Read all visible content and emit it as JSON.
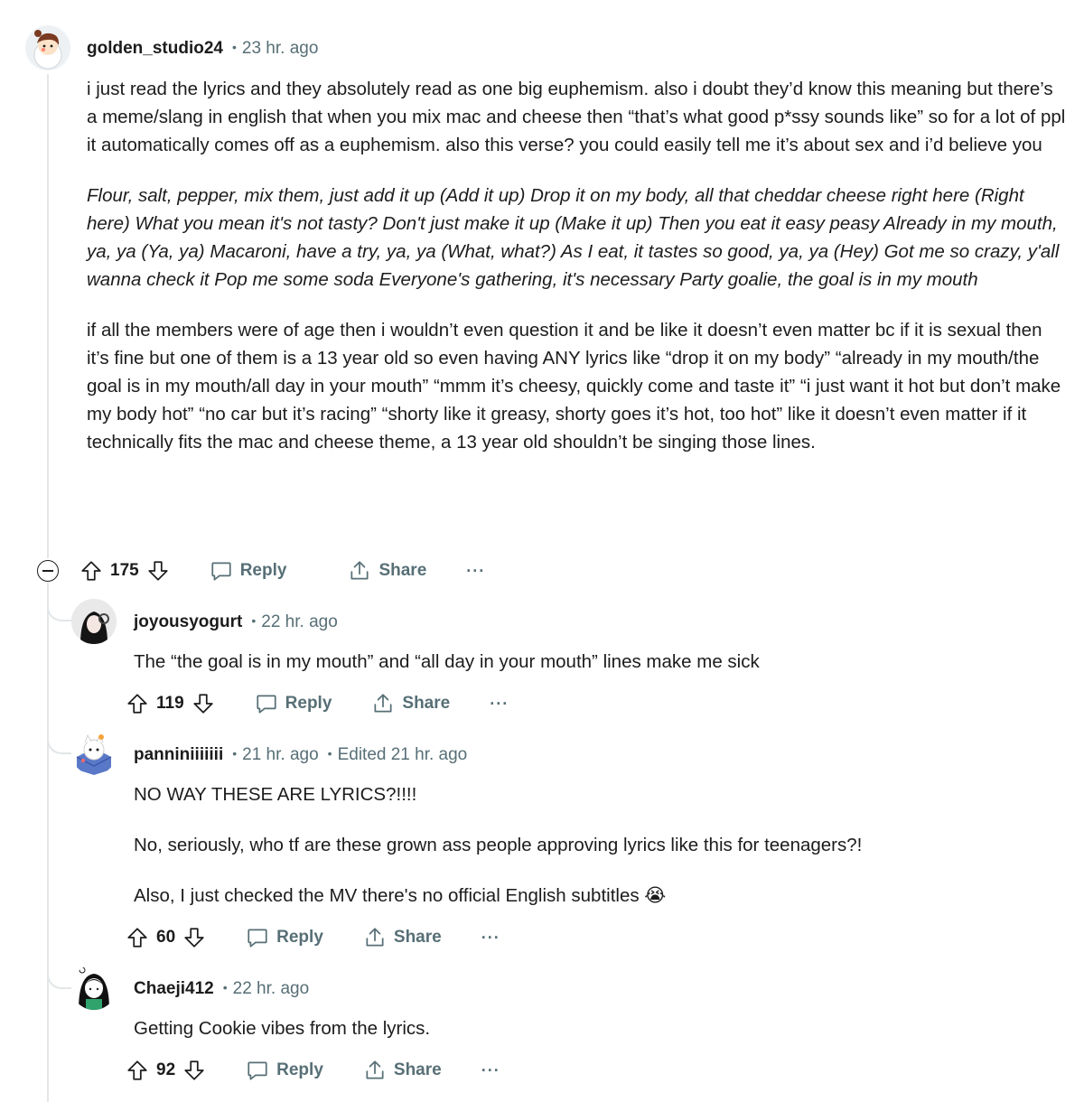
{
  "comments": [
    {
      "user": "golden_studio24",
      "time": "23 hr. ago",
      "paragraphs": [
        "i just read the lyrics and they absolutely read as one big euphemism. also i doubt they’d know this meaning but there’s a meme/slang in english that when you mix mac and cheese then “that’s what good p*ssy sounds like” so for a lot of ppl it automatically comes off as a euphemism. also this verse? you could easily tell me it’s about sex and i’d believe you",
        "Flour, salt, pepper, mix them, just add it up (Add it up) Drop it on my body, all that cheddar cheese right here (Right here) What you mean it's not tasty? Don't just make it up (Make it up) Then you eat it easy peasy Already in my mouth, ya, ya (Ya, ya) Macaroni, have a try, ya, ya (What, what?) As I eat, it tastes so good, ya, ya (Hey) Got me so crazy, y'all wanna check it Pop me some soda Everyone's gathering, it's necessary Party goalie, the goal is in my mouth",
        "if all the members were of age then i wouldn’t even question it and be like it doesn’t even matter bc if it is sexual then it’s fine but one of them is a 13 year old so even having ANY lyrics like “drop it on my body” “already in my mouth/the goal is in my mouth/all day in your mouth” “mmm it’s cheesy, quickly come and taste it” “i just want it hot but don’t make my body hot” “no car but it’s racing” “shorty like it greasy, shorty goes it’s hot, too hot” like it doesn’t even matter if it technically fits the mac and cheese theme, a 13 year old shouldn’t be singing those lines."
      ],
      "votes": "175"
    },
    {
      "user": "joyousyogurt",
      "time": "22 hr. ago",
      "paragraphs": [
        "The “the goal is in my mouth” and “all day in your mouth” lines make me sick"
      ],
      "votes": "119"
    },
    {
      "user": "panniniiiiiii",
      "time": "21 hr. ago",
      "edited": "Edited 21 hr. ago",
      "paragraphs": [
        "NO WAY THESE ARE LYRICS?!!!!",
        "No, seriously, who tf are these grown ass people approving lyrics like this for teenagers?!",
        "Also, I just checked the MV there's no official English subtitles 😭"
      ],
      "votes": "60"
    },
    {
      "user": "Chaeji412",
      "time": "22 hr. ago",
      "paragraphs": [
        "Getting Cookie vibes from the lyrics."
      ],
      "votes": "92"
    }
  ],
  "labels": {
    "reply": "Reply",
    "share": "Share",
    "more": "···",
    "dot": "•"
  },
  "icons": [
    "upvote-icon",
    "downvote-icon",
    "reply-bubble-icon",
    "share-icon",
    "collapse-icon"
  ],
  "colors": {
    "meta": "#576f76",
    "text": "#1c1c1c",
    "thread": "#e3e6e8"
  }
}
